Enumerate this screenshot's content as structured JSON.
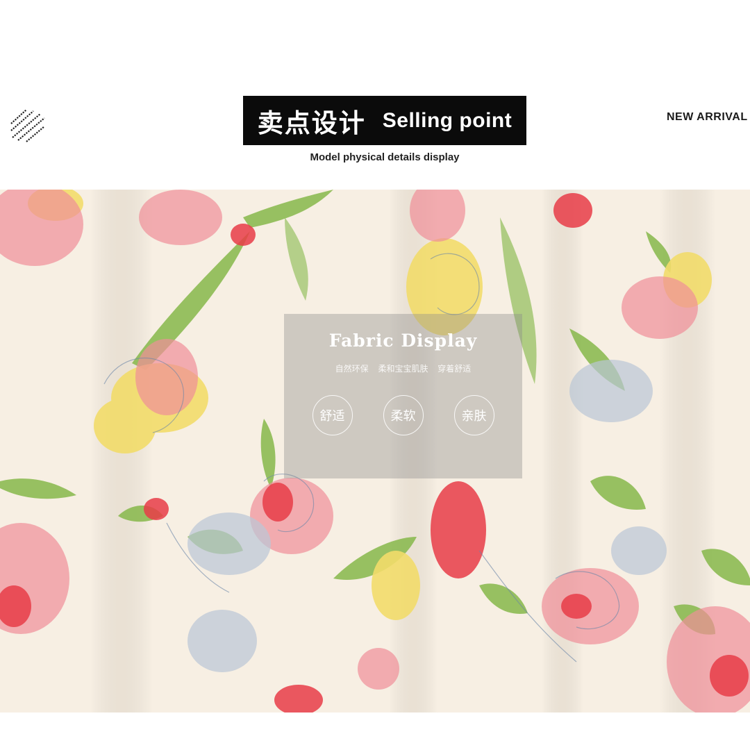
{
  "header": {
    "title_cn": "卖点设计",
    "title_en": "Selling point",
    "subtitle": "Model physical details display",
    "new_arrival": "NEW ARRIVAL",
    "decoration_icon": "diagonal-stripes-icon"
  },
  "panel": {
    "title": "Fabric Display",
    "subtitle": "自然环保 柔和宝宝肌肤 穿着舒适",
    "badges": [
      "舒适",
      "柔软",
      "亲肤"
    ]
  },
  "colors": {
    "background": "#ffffff",
    "title_box": "#0b0b0b",
    "fabric_base": "#f7efe3",
    "flower_pink": "#ef8f99",
    "flower_red": "#e83c48",
    "flower_yellow": "#f2dc6a",
    "leaf_green": "#86b84a",
    "flower_blue": "#b9c6d6"
  }
}
